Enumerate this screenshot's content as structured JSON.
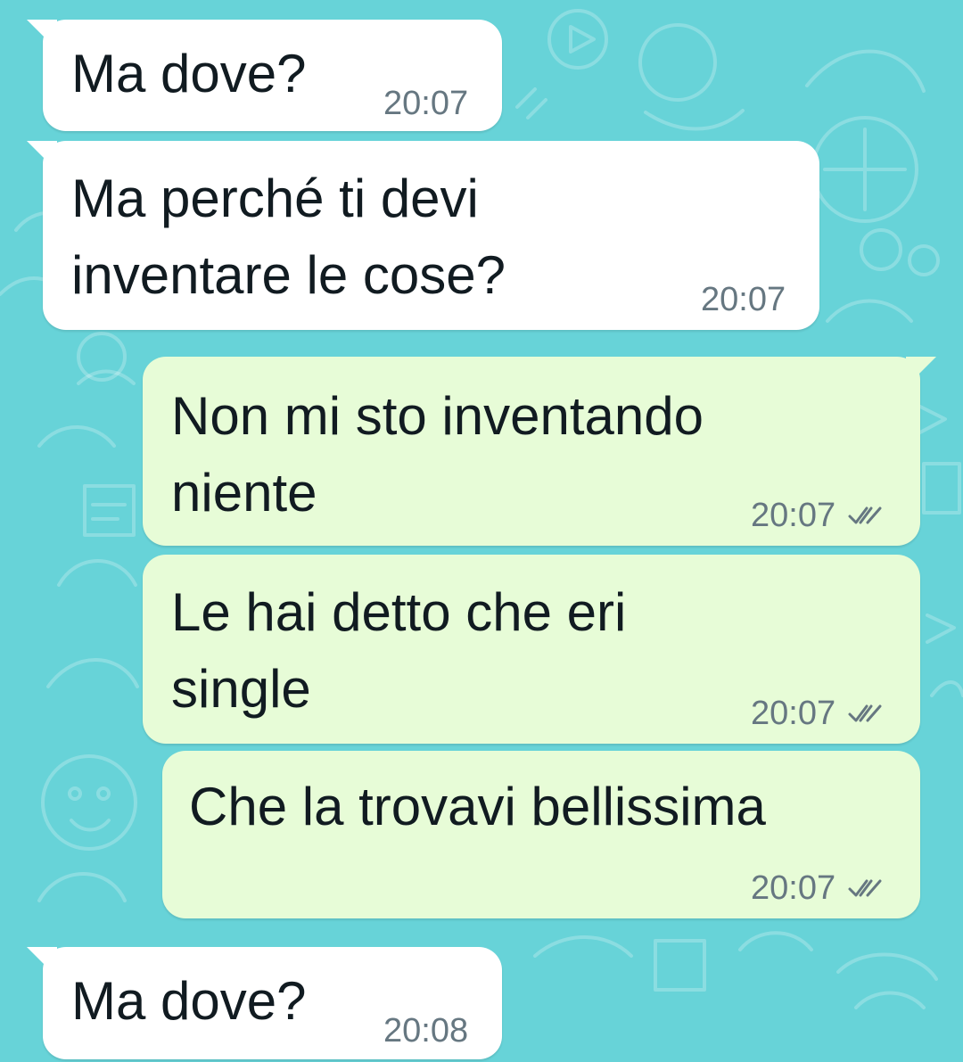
{
  "theme": {
    "wallpaper_color": "#67d3d8",
    "incoming_bubble_color": "#ffffff",
    "outgoing_bubble_color": "#e7fcd7",
    "text_color": "#111b21",
    "meta_color": "#667781"
  },
  "messages": [
    {
      "direction": "incoming",
      "lines": [
        "Ma dove?"
      ],
      "time": "20:07"
    },
    {
      "direction": "incoming",
      "lines": [
        "Ma perché ti devi",
        "inventare le cose?"
      ],
      "time": "20:07"
    },
    {
      "direction": "outgoing",
      "lines": [
        "Non mi sto inventando",
        "niente"
      ],
      "time": "20:07",
      "status_icon": "double-check-icon"
    },
    {
      "direction": "outgoing",
      "lines": [
        "Le hai detto che eri",
        "single"
      ],
      "time": "20:07",
      "status_icon": "double-check-icon"
    },
    {
      "direction": "outgoing",
      "lines": [
        "Che la trovavi bellissima"
      ],
      "time": "20:07",
      "status_icon": "double-check-icon"
    },
    {
      "direction": "incoming",
      "lines": [
        "Ma dove?"
      ],
      "time": "20:08"
    }
  ]
}
